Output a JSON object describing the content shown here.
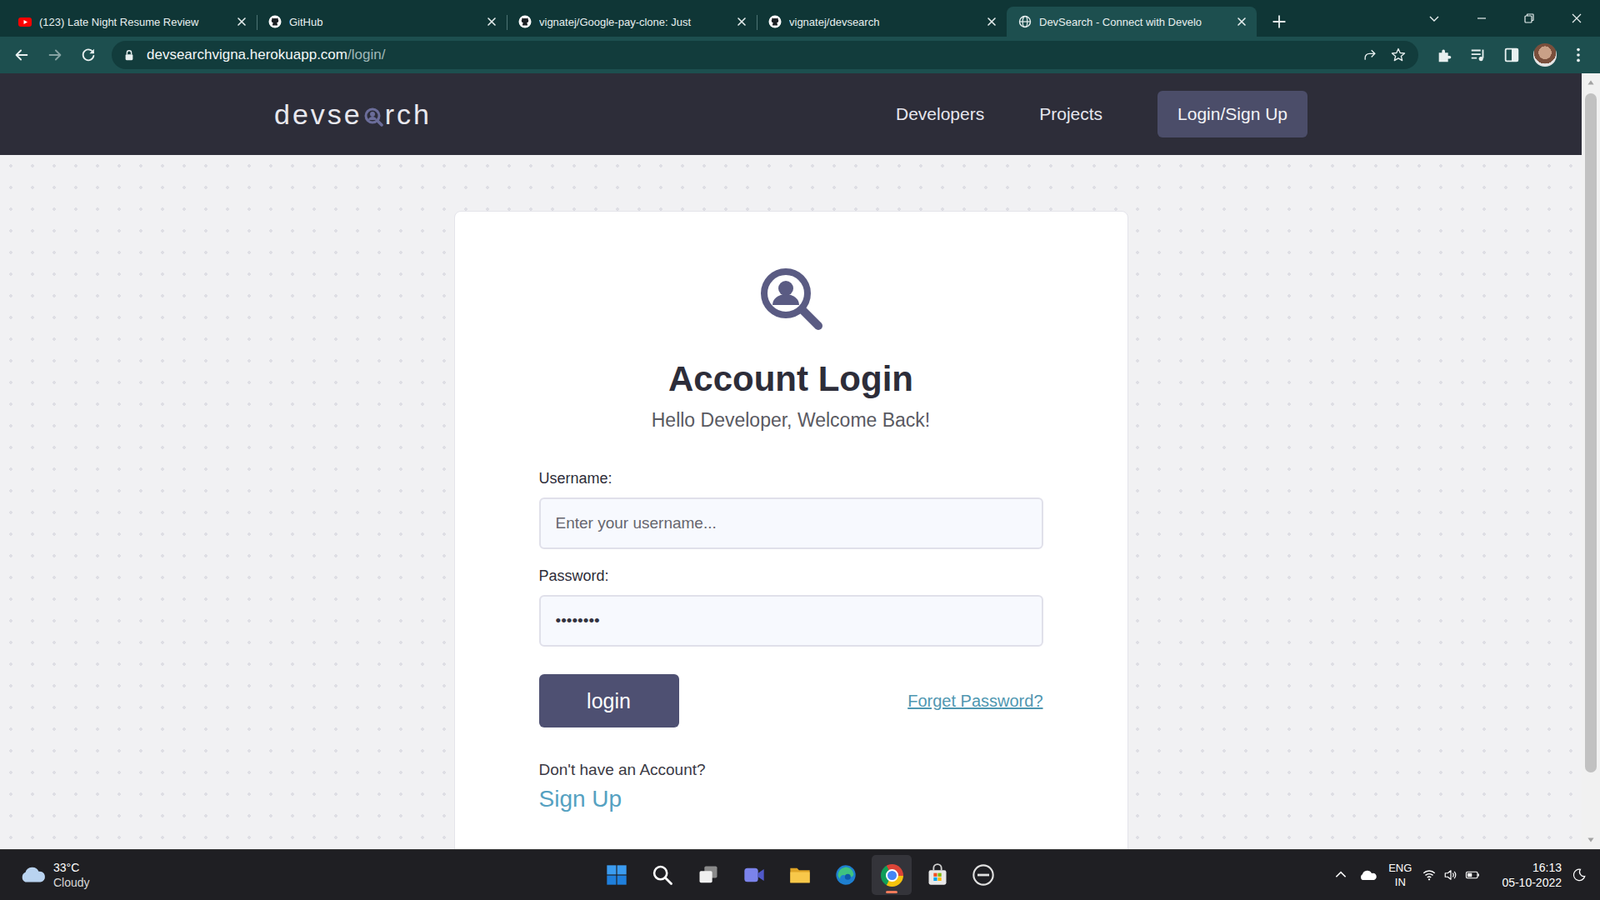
{
  "browser": {
    "tabs": [
      {
        "label": "(123) Late Night Resume Review",
        "kind": "youtube",
        "selected": false
      },
      {
        "label": "GitHub",
        "kind": "github",
        "selected": false
      },
      {
        "label": "vignatej/Google-pay-clone: Just",
        "kind": "github",
        "selected": false
      },
      {
        "label": "vignatej/devsearch",
        "kind": "github",
        "selected": false
      },
      {
        "label": "DevSearch - Connect with Develo",
        "kind": "globe",
        "selected": true
      }
    ],
    "address": {
      "host": "devsearchvigna.herokuapp.com",
      "path": "/login/"
    }
  },
  "site": {
    "logo": {
      "before": "devse",
      "after": "rch"
    },
    "nav": [
      {
        "label": "Developers",
        "kind": "link"
      },
      {
        "label": "Projects",
        "kind": "link"
      },
      {
        "label": "Login/Sign Up",
        "kind": "button"
      }
    ]
  },
  "login": {
    "title": "Account Login",
    "subtitle": "Hello Developer, Welcome Back!",
    "fields": [
      {
        "label": "Username:",
        "placeholder": "Enter your username...",
        "value": ""
      },
      {
        "label": "Password:",
        "placeholder": "",
        "value": "••••••••"
      }
    ],
    "submit": "login",
    "forgot": "Forget Password?",
    "prompt": "Don't have an Account?",
    "signup": "Sign Up"
  },
  "taskbar": {
    "weather": {
      "temp": "33°C",
      "condition": "Cloudy"
    },
    "apps": [
      {
        "kind": "start",
        "active": false
      },
      {
        "kind": "search",
        "active": false
      },
      {
        "kind": "taskview",
        "active": false
      },
      {
        "kind": "chat",
        "active": false
      },
      {
        "kind": "explorer",
        "active": false
      },
      {
        "kind": "edge",
        "active": false
      },
      {
        "kind": "chrome",
        "active": true
      },
      {
        "kind": "store",
        "active": false
      },
      {
        "kind": "dell",
        "active": false
      }
    ],
    "language": {
      "code": "ENG",
      "region": "IN"
    },
    "clock": {
      "time": "16:13",
      "date": "05-10-2022"
    }
  }
}
